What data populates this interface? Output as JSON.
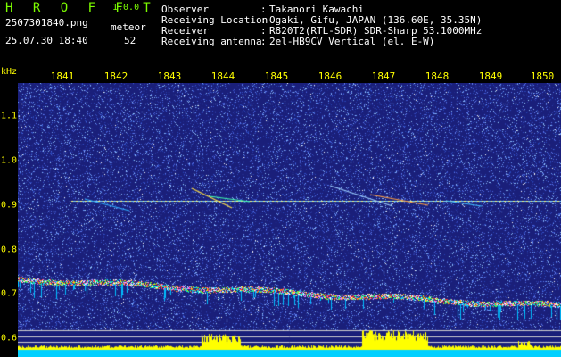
{
  "header": {
    "app_title": "H R O F F T",
    "version": "1.0.0",
    "file_name": "2507301840.png",
    "timestamp": "25.07.30 18:40",
    "count_label": "meteor",
    "count_value": "52",
    "meta": [
      {
        "key": "Observer",
        "value": "Takanori Kawachi"
      },
      {
        "key": "Receiving Location",
        "value": "Ogaki, Gifu, JAPAN (136.60E, 35.35N)"
      },
      {
        "key": "Receiver",
        "value": "R820T2(RTL-SDR) SDR-Sharp 53.1000MHz"
      },
      {
        "key": "Receiving antenna",
        "value": "2el-HB9CV Vertical (el. E-W)"
      }
    ],
    "separator": ":"
  },
  "axes": {
    "y_unit": "kHz",
    "x_ticks": [
      "1841",
      "1842",
      "1843",
      "1844",
      "1845",
      "1846",
      "1847",
      "1848",
      "1849",
      "1850"
    ],
    "y_ticks": [
      "1.1",
      "1.0",
      "0.9",
      "0.8",
      "0.7",
      "0.6"
    ]
  },
  "colors": {
    "background": "#1a1f7a",
    "label": "#FFFF00",
    "title": "#7CFC00",
    "text": "#FFFFFF",
    "power_bar": "#FFFF00",
    "baseline": "#00D0FF"
  }
}
